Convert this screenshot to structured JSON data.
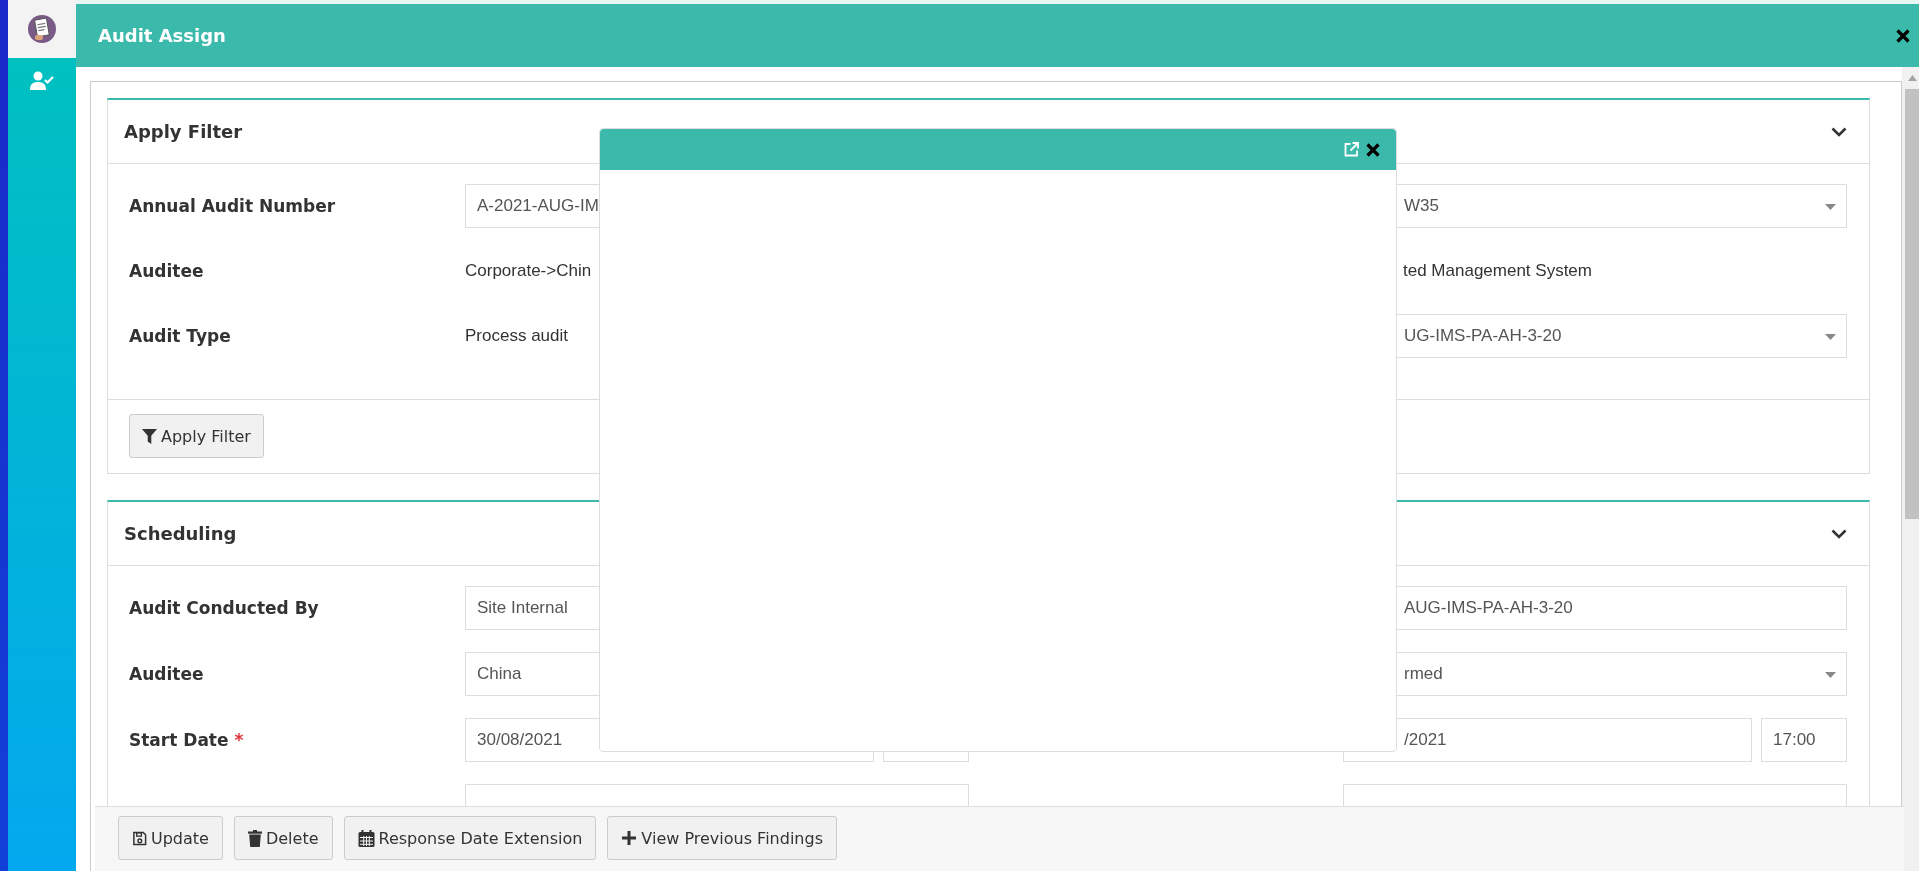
{
  "sidebar": {
    "items": [
      {
        "kind": "logo",
        "selected": true
      },
      {
        "kind": "user-check",
        "selected": false
      }
    ]
  },
  "dialog": {
    "title": "Audit Assign"
  },
  "filter_panel": {
    "title": "Apply Filter",
    "expanded": true,
    "rows": [
      {
        "left": {
          "label": "Annual Audit Number",
          "kind": "input",
          "value": "A-2021-AUG-IM"
        },
        "right": {
          "kind": "select",
          "value": "W35"
        }
      },
      {
        "left": {
          "label": "Auditee",
          "kind": "plain",
          "value": "Corporate->Chin"
        },
        "right": {
          "kind": "plain",
          "value": "ted Management System"
        }
      },
      {
        "left": {
          "label": "Audit Type",
          "kind": "plain",
          "value": "Process audit"
        },
        "right": {
          "kind": "select",
          "value": "UG-IMS-PA-AH-3-20"
        }
      }
    ],
    "button": "Apply Filter"
  },
  "scheduling_panel": {
    "title": "Scheduling",
    "expanded": true,
    "rows": [
      {
        "left": {
          "label": "Audit Conducted By",
          "kind": "input",
          "value": "Site Internal"
        },
        "right": {
          "kind": "input",
          "value": "AUG-IMS-PA-AH-3-20"
        }
      },
      {
        "left": {
          "label": "Auditee",
          "kind": "input",
          "value": "China"
        },
        "right": {
          "kind": "select",
          "value": "rmed"
        }
      },
      {
        "left": {
          "label": "Start Date",
          "required_mark": "*",
          "kind": "datetime",
          "value": "30/08/2021"
        },
        "right": {
          "kind": "datetime",
          "value": "/2021",
          "time": "17:00"
        }
      },
      {
        "left": {
          "kind": "input"
        },
        "right": {
          "kind": "input"
        }
      }
    ]
  },
  "footer": {
    "buttons": [
      {
        "label": "Update",
        "kind": "save"
      },
      {
        "label": "Delete",
        "kind": "delete"
      },
      {
        "label": "Response Date Extension",
        "kind": "extension"
      },
      {
        "label": "View Previous Findings",
        "kind": "add"
      }
    ]
  },
  "popup": {
    "buttons": [
      {
        "kind": "open-external"
      },
      {
        "kind": "close"
      }
    ]
  }
}
